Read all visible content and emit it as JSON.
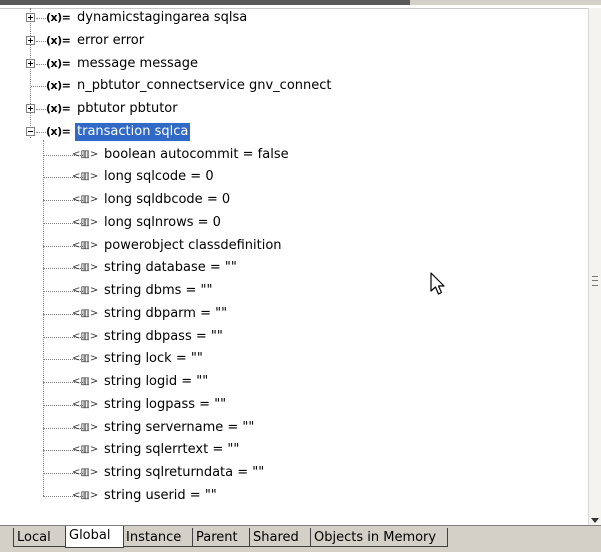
{
  "tree": {
    "top_items": [
      {
        "label": "dynamicstagingarea sqlsa",
        "expander": "plus"
      },
      {
        "label": "error error",
        "expander": "plus"
      },
      {
        "label": "message message",
        "expander": "plus"
      },
      {
        "label": "n_pbtutor_connectservice gnv_connect",
        "expander": "none"
      },
      {
        "label": "pbtutor pbtutor",
        "expander": "plus"
      },
      {
        "label": "transaction sqlca",
        "expander": "minus",
        "selected": true
      }
    ],
    "var_icon": "(x)=",
    "field_icon": "<▥>",
    "children": [
      "boolean autocommit = false",
      "long sqlcode = 0",
      "long sqldbcode = 0",
      "long sqlnrows = 0",
      "powerobject classdefinition",
      "string database = \"\"",
      "string dbms = \"\"",
      "string dbparm = \"\"",
      "string dbpass = \"\"",
      "string lock = \"\"",
      "string logid = \"\"",
      "string logpass = \"\"",
      "string servername = \"\"",
      "string sqlerrtext = \"\"",
      "string sqlreturndata = \"\"",
      "string userid = \"\""
    ]
  },
  "tabs": [
    {
      "label": "Local",
      "active": false
    },
    {
      "label": "Global",
      "active": true
    },
    {
      "label": "Instance",
      "active": false
    },
    {
      "label": "Parent",
      "active": false
    },
    {
      "label": "Shared",
      "active": false
    },
    {
      "label": "Objects in Memory",
      "active": false
    }
  ],
  "colors": {
    "selection": "#3169c6",
    "tab_bar": "#d4d0c8"
  }
}
